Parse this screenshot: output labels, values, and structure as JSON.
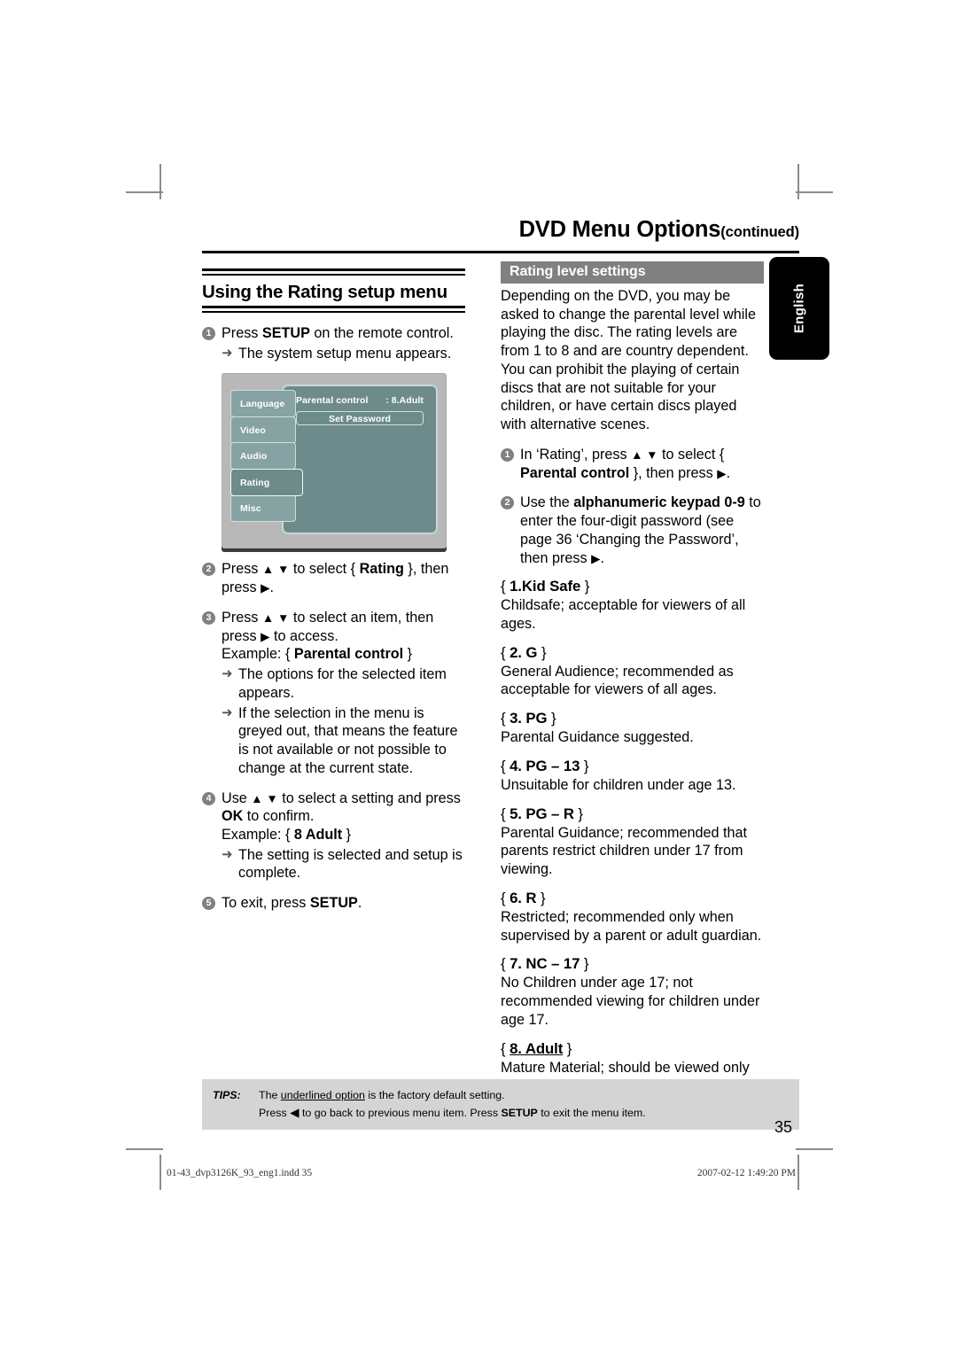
{
  "running_head": {
    "title": "DVD Menu Options",
    "suffix": "(continued)"
  },
  "language_tab": {
    "label": "English"
  },
  "left_column": {
    "section_title": "Using the Rating setup menu",
    "steps": [
      {
        "num": "1",
        "text_html": "Press <b>SETUP</b> on the remote control.",
        "subs": [
          {
            "arrow": "➜",
            "text_html": "The system setup menu appears."
          }
        ]
      },
      {
        "num": "2",
        "text_html": "Press <span class=\"tri\">▲ ▼</span> to select { <b>Rating</b> }, then press <span class=\"tri\">▶</span>.",
        "subs": []
      },
      {
        "num": "3",
        "text_html": "Press <span class=\"tri\">▲ ▼</span> to select an item, then press <span class=\"tri\">▶</span> to access.<br>Example: { <b>Parental control</b> }",
        "subs": [
          {
            "arrow": "➜",
            "text_html": "The options for the selected item appears."
          },
          {
            "arrow": "➜",
            "text_html": "If the selection in the menu is greyed out, that means the feature is not available or not possible to change at the current state."
          }
        ]
      },
      {
        "num": "4",
        "text_html": "Use <span class=\"tri\">▲ ▼</span> to select a setting and press <b>OK</b> to confirm.<br>Example: { <b>8 Adult</b> }",
        "subs": [
          {
            "arrow": "➜",
            "text_html": "The setting is selected and setup is complete."
          }
        ]
      },
      {
        "num": "5",
        "text_html": "To exit, press <b>SETUP</b>.",
        "subs": []
      }
    ]
  },
  "osd": {
    "tabs": [
      {
        "label": "Language",
        "selected": false
      },
      {
        "label": "Video",
        "selected": false
      },
      {
        "label": "Audio",
        "selected": false
      },
      {
        "label": "Rating",
        "selected": true
      },
      {
        "label": "Misc",
        "selected": false
      }
    ],
    "row_label": "Parental control",
    "row_value": ": 8.Adult",
    "button_label": "Set Password"
  },
  "right_column": {
    "panel_heading": "Rating level settings",
    "intro": "Depending on the DVD, you may be asked to change the parental level while playing the disc. The rating levels are from 1 to 8 and are country dependent. You can prohibit the playing of certain discs that are not suitable for your children, or have certain discs played with alternative scenes.",
    "steps": [
      {
        "num": "1",
        "text_html": "In ‘Rating’, press <span class=\"tri\">▲ ▼</span> to select { <b>Parental control</b> }, then press <span class=\"tri\">▶</span>."
      },
      {
        "num": "2",
        "text_html": "Use the <b>alphanumeric keypad 0-9</b> to enter the four-digit password (see page 36 ‘Changing the Password’, then press <span class=\"tri\">▶</span>."
      }
    ],
    "rating_levels": [
      {
        "term_html": "<span class=\"brace\">{ </span>1.Kid Safe<span class=\"brace\"> }</span>",
        "description": "Childsafe; acceptable for viewers of all ages."
      },
      {
        "term_html": "<span class=\"brace\">{ </span>2. G<span class=\"brace\"> }</span>",
        "description": "General Audience; recommended as acceptable for viewers of all ages."
      },
      {
        "term_html": "<span class=\"brace\">{ </span>3. PG<span class=\"brace\"> }</span>",
        "description": "Parental Guidance suggested."
      },
      {
        "term_html": "<span class=\"brace\">{ </span>4. PG – 13<span class=\"brace\"> }</span>",
        "description": "Unsuitable for children under age 13."
      },
      {
        "term_html": "<span class=\"brace\">{ </span>5. PG – R<span class=\"brace\"> }</span>",
        "description": "Parental Guidance; recommended that parents restrict children under 17 from viewing."
      },
      {
        "term_html": "<span class=\"brace\">{ </span>6. R<span class=\"brace\"> }</span>",
        "description": "Restricted; recommended only when supervised by a parent or adult guardian."
      },
      {
        "term_html": "<span class=\"brace\">{ </span>7. NC – 17<span class=\"brace\"> }</span>",
        "description": "No Children under age 17; not recommended viewing for children under age 17."
      },
      {
        "term_html": "<span class=\"brace\">{ </span><u>8. Adult</u><span class=\"brace\"> }</span>",
        "description": "Mature Material; should be viewed only by adults due to graphic sexual material, violence or language."
      }
    ]
  },
  "tips": {
    "label": "TIPS:",
    "line1_html": "The <u>underlined option</u> is the factory default setting.",
    "line2_html": "Press <span class=\"tri\">◀</span> to go back to previous menu item. Press <b>SETUP</b> to exit the menu item."
  },
  "folio": "35",
  "imprint": {
    "left": "01-43_dvp3126K_93_eng1.indd   35",
    "right": "2007-02-12   1:49:20 PM"
  },
  "colors": {
    "panel_heading_bg": "#808080",
    "tips_bg": "#d4d4d4",
    "osd_frame": "#b8b8b8",
    "osd_panel": "#6e8b8b",
    "osd_tab": "#86a2a2",
    "step_number_bg": "#808080",
    "lang_tab_bg": "#000000"
  }
}
